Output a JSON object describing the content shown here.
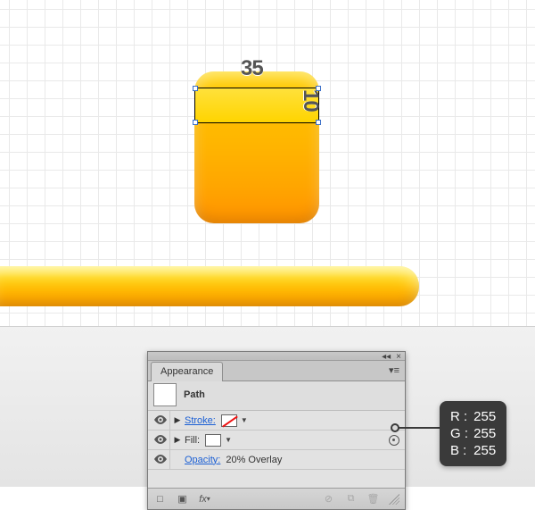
{
  "canvas": {
    "dim_width_label": "35",
    "dim_height_label": "10"
  },
  "panel": {
    "tab_label": "Appearance",
    "path_label": "Path",
    "rows": {
      "stroke": {
        "label": "Stroke:"
      },
      "fill": {
        "label": "Fill:"
      },
      "opacity": {
        "label": "Opacity:",
        "value": "20% Overlay"
      }
    },
    "footer": {
      "fx_label": "fx"
    }
  },
  "callout": {
    "r": {
      "label": "R :",
      "value": "255"
    },
    "g": {
      "label": "G :",
      "value": "255"
    },
    "b": {
      "label": "B :",
      "value": "255"
    }
  }
}
